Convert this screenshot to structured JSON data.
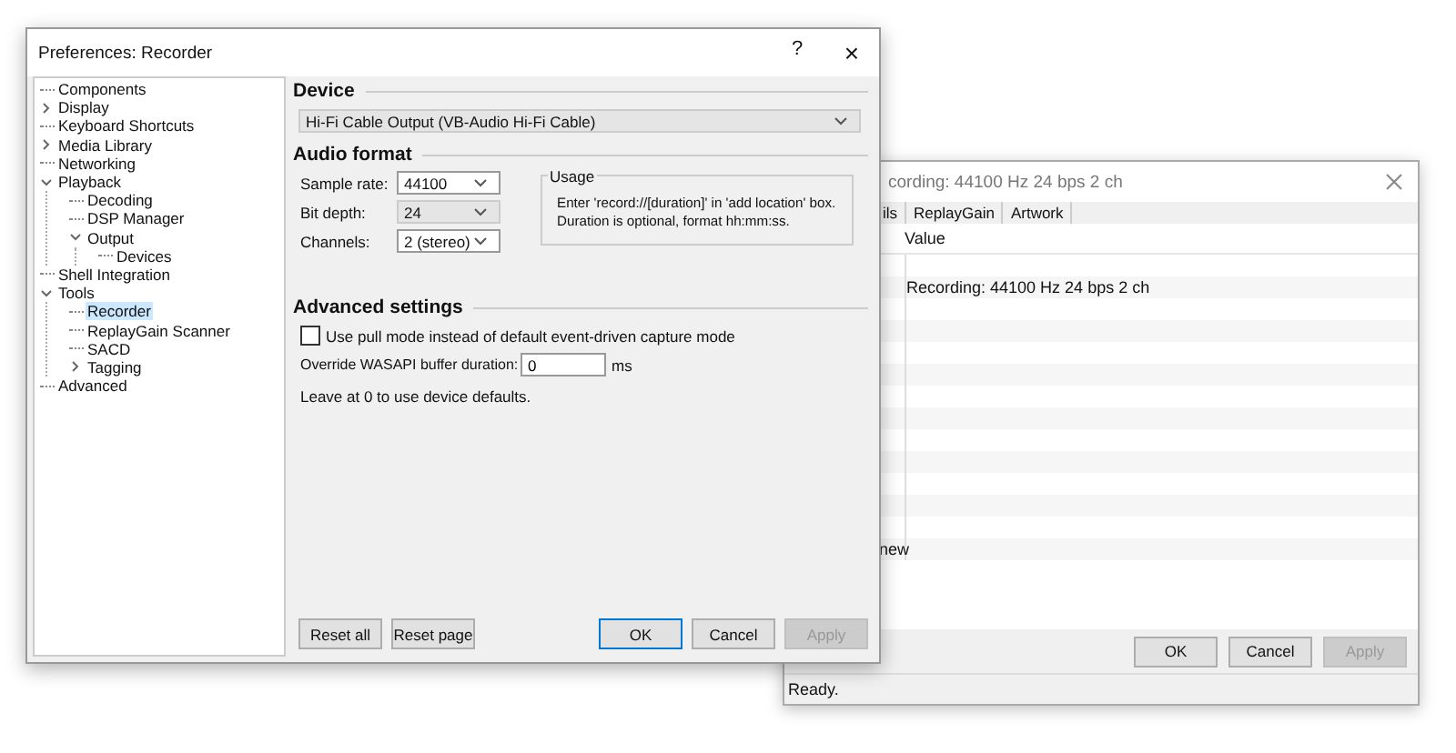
{
  "back_window": {
    "title": "cording: 44100 Hz 24 bps 2 ch",
    "tabs": [
      {
        "label": "ils",
        "selected": false
      },
      {
        "label": "ReplayGain",
        "selected": false
      },
      {
        "label": "Artwork",
        "selected": false
      }
    ],
    "columns": [
      "Value"
    ],
    "rows": [
      {},
      {
        "value": "Recording: 44100 Hz 24 bps 2 ch"
      },
      {},
      {},
      {},
      {},
      {},
      {},
      {},
      {},
      {},
      {},
      {},
      {
        "name": "new"
      }
    ],
    "buttons": [
      {
        "label": "OK",
        "disabled": false
      },
      {
        "label": "Cancel",
        "disabled": false
      },
      {
        "label": "Apply",
        "disabled": true
      }
    ],
    "status_bar": "Ready."
  },
  "window": {
    "title": "Preferences: Recorder",
    "help": "?",
    "close": "×"
  },
  "tree": [
    {
      "label": "Components",
      "selected": false
    },
    {
      "label": "Display",
      "selected": false,
      "expanded": false
    },
    {
      "label": "Keyboard Shortcuts",
      "selected": false
    },
    {
      "label": "Media Library",
      "selected": false,
      "expanded": false
    },
    {
      "label": "Networking",
      "selected": false
    },
    {
      "label": "Playback",
      "selected": false,
      "expanded": true,
      "children": [
        {
          "label": "Decoding",
          "selected": false
        },
        {
          "label": "DSP Manager",
          "selected": false
        },
        {
          "label": "Output",
          "selected": false,
          "expanded": true,
          "children": [
            {
              "label": "Devices",
              "selected": false
            }
          ]
        }
      ]
    },
    {
      "label": "Shell Integration",
      "selected": false
    },
    {
      "label": "Tools",
      "selected": false,
      "expanded": true,
      "children": [
        {
          "label": "Recorder",
          "selected": true
        },
        {
          "label": "ReplayGain Scanner",
          "selected": false
        },
        {
          "label": "SACD",
          "selected": false
        },
        {
          "label": "Tagging",
          "selected": false,
          "expanded": false
        }
      ]
    },
    {
      "label": "Advanced",
      "selected": false
    }
  ],
  "device": {
    "heading": "Device",
    "value": "Hi-Fi Cable Output (VB-Audio Hi-Fi Cable)"
  },
  "audio_format": {
    "heading": "Audio format",
    "fields": [
      {
        "label": "Sample rate:",
        "value": "44100",
        "disabled": false
      },
      {
        "label": "Bit depth:",
        "value": "24",
        "disabled": true
      },
      {
        "label": "Channels:",
        "value": "2 (stereo)",
        "disabled": false
      }
    ],
    "usage": {
      "title": "Usage",
      "text": "Enter 'record://[duration]' in 'add location' box. Duration is optional, format hh:mm:ss."
    }
  },
  "advanced": {
    "heading": "Advanced settings",
    "pull_mode": {
      "label": "Use pull mode instead of default event-driven capture mode",
      "checked": false
    },
    "buffer": {
      "label": "Override WASAPI buffer duration:",
      "value": "0",
      "unit": "ms"
    },
    "note": "Leave at 0 to use device defaults."
  },
  "buttons": [
    {
      "label": "Reset all",
      "default": false,
      "disabled": false
    },
    {
      "label": "Reset page",
      "default": false,
      "disabled": false
    },
    {
      "label": "OK",
      "default": true,
      "disabled": false
    },
    {
      "label": "Cancel",
      "default": false,
      "disabled": false
    },
    {
      "label": "Apply",
      "default": false,
      "disabled": true
    }
  ]
}
